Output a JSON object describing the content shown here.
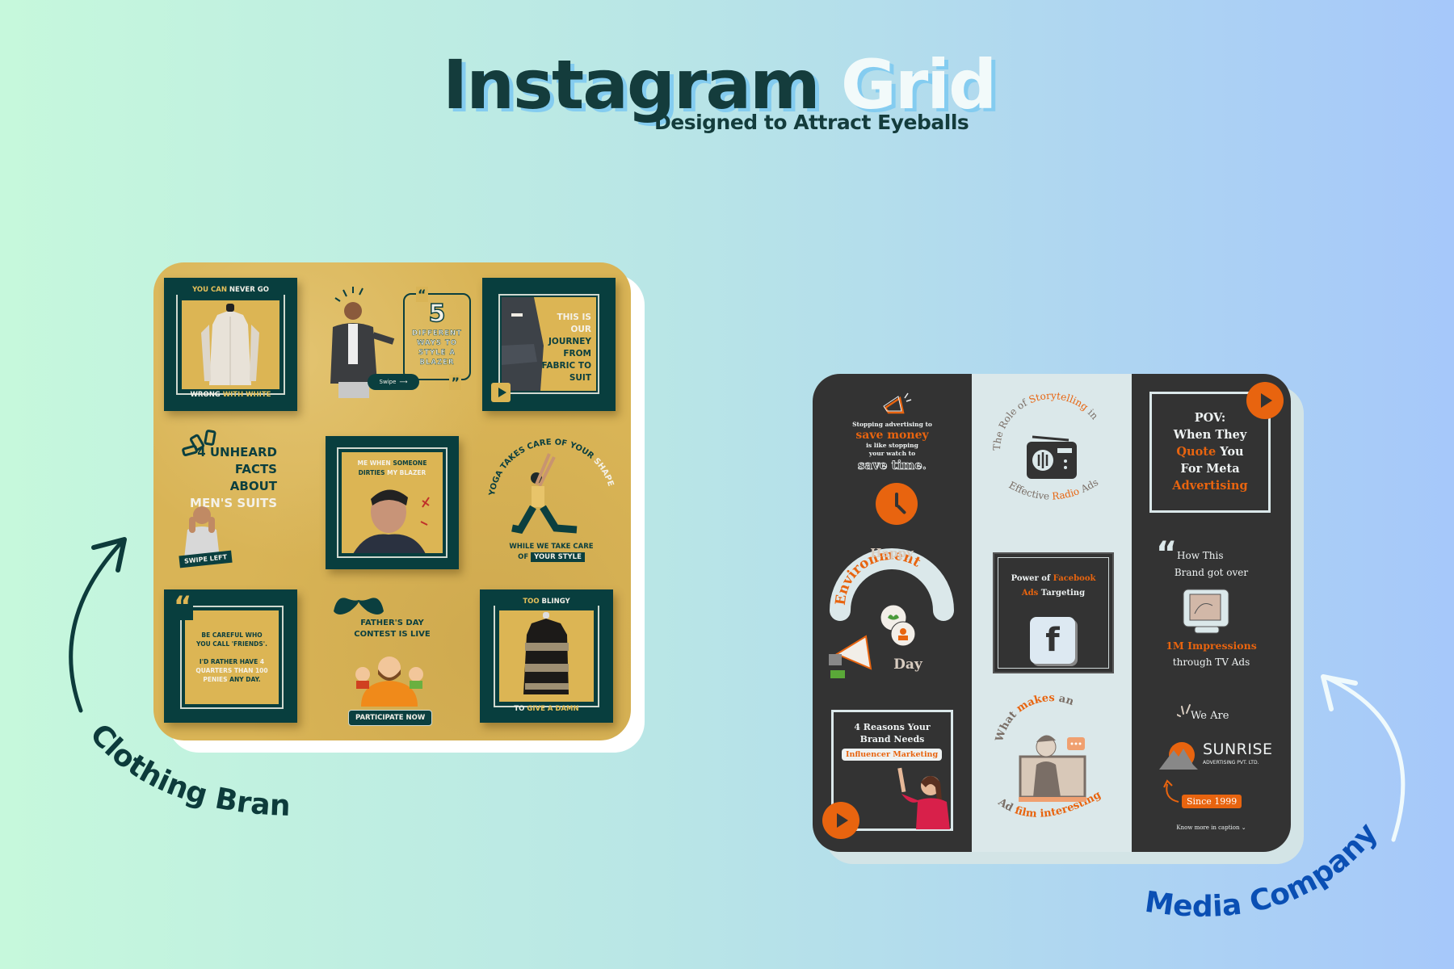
{
  "header": {
    "title_part1": "Instagram",
    "title_part2": "Grid",
    "subtitle": "Designed to Attract Eyeballs"
  },
  "colors": {
    "background_left": "#c6f8dc",
    "background_right": "#a6c8fa",
    "title_dark": "#143c3c",
    "title_shadow": "#84ccf0",
    "clothing_gold": "#d9b456",
    "clothing_green": "#083e3e",
    "media_dark": "#333333",
    "media_light": "#dbe8ea",
    "media_orange": "#e8640f",
    "media_label_blue": "#0a4fb4"
  },
  "clothing_brand": {
    "label": "Clothing Brand",
    "posts": [
      {
        "id": "white-jacket",
        "top_caption_a": "YOU CAN",
        "top_caption_b": "NEVER GO",
        "bottom_caption_a": "WRONG",
        "bottom_caption_b": "WITH WHITE"
      },
      {
        "id": "blazer-styles",
        "number": "5",
        "lines": [
          "DIFFERENT",
          "WAYS TO",
          "STYLE A",
          "BLAZER"
        ],
        "button": "Swipe",
        "open_quote": "“",
        "close_quote": "”"
      },
      {
        "id": "journey",
        "lines": [
          "THIS IS",
          "OUR",
          "JOURNEY",
          "FROM",
          "FABRIC TO",
          "SUIT"
        ]
      },
      {
        "id": "suit-facts",
        "lines": [
          "4 UNHEARD",
          "FACTS",
          "ABOUT",
          "MEN'S SUITS"
        ],
        "badge": "SWIPE LEFT"
      },
      {
        "id": "blazer-meme",
        "line1_a": "ME WHEN",
        "line1_b": "SOMEONE",
        "line2_a": "DIRTIES",
        "line2_b": "MY BLAZER"
      },
      {
        "id": "yoga",
        "arc_text": "YOGA TAKES CARE OF YOUR",
        "arc_end": "SHAPE",
        "line1": "WHILE WE TAKE CARE",
        "line2_a": "OF",
        "line2_b": "YOUR STYLE"
      },
      {
        "id": "friends-quote",
        "quote_mark": "“",
        "line1": "BE CAREFUL WHO",
        "line2": "YOU CALL 'FRIENDS'.",
        "line3_a": "I'D RATHER HAVE",
        "line3_b": "4",
        "line4": "QUARTERS THAN 100",
        "line5_a": "PENIES",
        "line5_b": "ANY DAY."
      },
      {
        "id": "fathers-day",
        "line1": "FATHER'S DAY",
        "line2": "CONTEST IS LIVE",
        "button": "PARTICIPATE NOW"
      },
      {
        "id": "blingy-jacket",
        "top_caption_a": "TOO",
        "top_caption_b": "BLINGY",
        "bottom_caption_a": "TO",
        "bottom_caption_b": "GIVE A DAMN"
      }
    ]
  },
  "media_company": {
    "label": "Media Company",
    "posts": [
      {
        "id": "save-money",
        "line1": "Stopping advertising to",
        "highlight": "save money",
        "line2": "is like stopping",
        "line3": "your watch to",
        "line4": "save time."
      },
      {
        "id": "radio-ads",
        "arc_top_a": "The Role of",
        "arc_top_b": "Storytelling",
        "arc_top_c": "in",
        "arc_bottom_a": "Effective",
        "arc_bottom_b": "Radio",
        "arc_bottom_c": "Ads"
      },
      {
        "id": "pov-meta",
        "line1": "POV:",
        "line2": "When They",
        "line3_a": "Quote",
        "line3_b": "You",
        "line4": "For Meta",
        "line5": "Advertising"
      },
      {
        "id": "environment-day",
        "line1": "Happy",
        "line2": "Environment",
        "line3": "Day"
      },
      {
        "id": "facebook-ads",
        "line1_a": "Power of",
        "line1_b": "Facebook",
        "line2_a": "Ads",
        "line2_b": "Targeting",
        "icon_letter": "f"
      },
      {
        "id": "tv-ads",
        "quote_mark": "“",
        "line1": "How This",
        "line2": "Brand got over",
        "highlight": "1M Impressions",
        "line3": "through TV Ads"
      },
      {
        "id": "influencer",
        "line1": "4 Reasons Your",
        "line2": "Brand Needs",
        "badge": "Influencer Marketing"
      },
      {
        "id": "ad-film",
        "arc_top_a": "What",
        "arc_top_b": "makes",
        "arc_top_c": "an",
        "arc_bottom_a": "Ad",
        "arc_bottom_b": "film interesting?"
      },
      {
        "id": "sunrise",
        "intro": "We Are",
        "brand": "SUNRISE",
        "brand_sub": "ADVERTISING PVT. LTD.",
        "since": "Since 1999",
        "caption": "Know more in caption"
      }
    ]
  }
}
